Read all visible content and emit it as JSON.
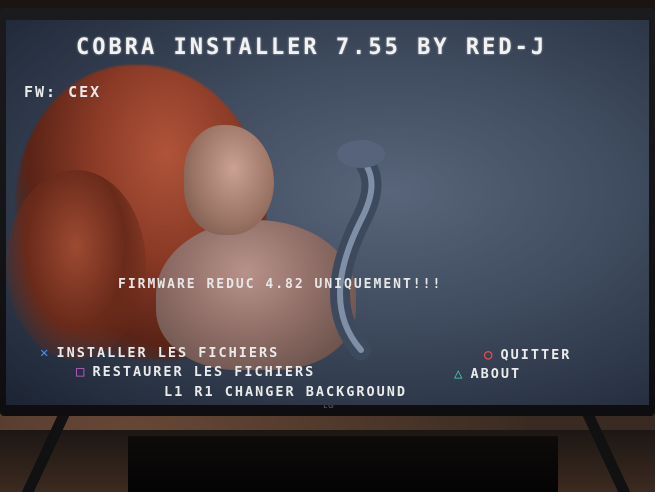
{
  "screen": {
    "title": "COBRA INSTALLER 7.55 BY RED-J",
    "firmware": "FW: CEX",
    "warning": "FIRMWARE REDUC 4.82 UNIQUEMENT!!!"
  },
  "menu": {
    "install": {
      "icon": "cross-button-icon",
      "glyph": "✕",
      "label": "INSTALLER LES FICHIERS"
    },
    "restore": {
      "icon": "square-button-icon",
      "glyph": "□",
      "label": "RESTAURER LES FICHIERS"
    },
    "quit": {
      "icon": "circle-button-icon",
      "glyph": "○",
      "label": "QUITTER"
    },
    "about": {
      "icon": "triangle-button-icon",
      "glyph": "△",
      "label": "ABOUT"
    },
    "background": {
      "label": "L1  R1  CHANGER BACKGROUND"
    }
  },
  "tv": {
    "brand": "LG"
  },
  "colors": {
    "cross": "#4d8cf0",
    "square": "#d064d6",
    "circle": "#ff4a4a",
    "triangle": "#4fd6c8",
    "text": "#eaeaea"
  }
}
